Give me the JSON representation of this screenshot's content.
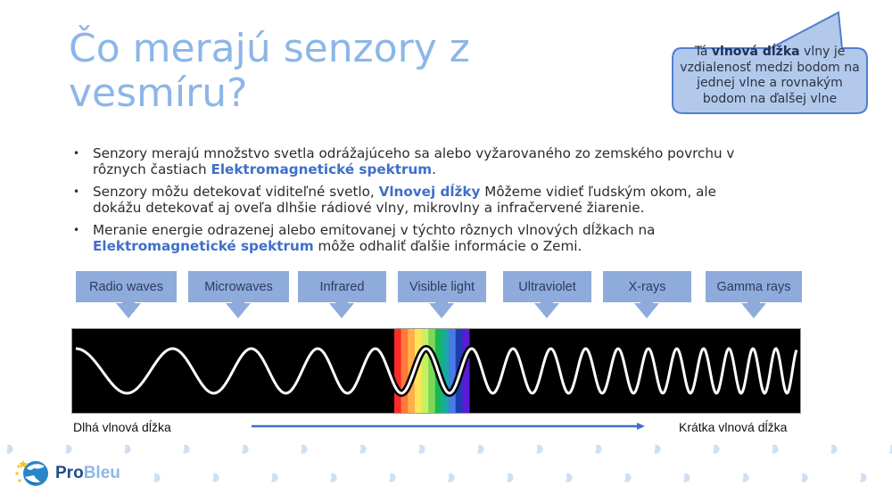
{
  "slide": {
    "title": "Čo merajú senzory z vesmíru?",
    "callout": {
      "prefix": "Tá ",
      "bold": "vlnová dĺžka",
      "suffix": " vlny je vzdialenosť medzi bodom na jednej vlne a rovnakým bodom na ďalšej vlne"
    },
    "bullets": [
      {
        "before": "Senzory merajú množstvo svetla odrážajúceho sa alebo vyžarovaného zo zemského povrchu v rôznych častiach ",
        "highlight": "Elektromagnetické spektrum",
        "after": "."
      },
      {
        "before": "Senzory môžu detekovať viditeľné svetlo, ",
        "highlight": "Vlnovej dĺžky",
        "after": " Môžeme vidieť ľudským okom, ale dokážu detekovať aj oveľa dlhšie rádiové vlny, mikrovlny a infračervené žiarenie."
      },
      {
        "before": "Meranie energie odrazenej alebo emitovanej v týchto rôznych vlnových dĺžkach na ",
        "highlight": "Elektromagnetické spektrum",
        "after": " môže odhaliť ďalšie informácie o Zemi."
      }
    ],
    "bands": [
      "Radio waves",
      "Microwaves",
      "Infrared",
      "Visible light",
      "Ultraviolet",
      "X-rays",
      "Gamma rays"
    ],
    "visible_spectrum_colors": [
      "#ff2a2a",
      "#ff7a3a",
      "#ffb04a",
      "#ffe45a",
      "#c8f060",
      "#7ed858",
      "#18b85a",
      "#19a8a0",
      "#4a7ae8",
      "#1c3fb0",
      "#5a1ad8"
    ],
    "axis": {
      "long_label": "Dlhá vlnová dĺžka",
      "short_label": "Krátka vlnová dĺžka"
    },
    "logo": {
      "pro": "Pro",
      "bleu": "Bleu"
    },
    "colors": {
      "title": "#8cb6e8",
      "highlight": "#3f6fc8",
      "band_box": "#8fabdc",
      "callout_fill": "#b3c9ec",
      "callout_border": "#4f7fcf",
      "arrow": "#3f6fc8",
      "drops": "#cfe0f5"
    }
  }
}
